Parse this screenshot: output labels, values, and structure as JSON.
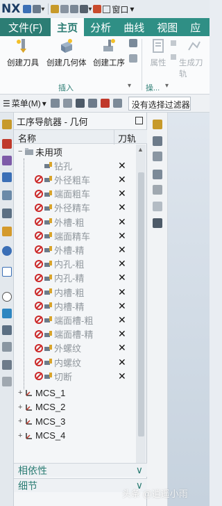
{
  "app": {
    "logo": "NX",
    "window_menu": "窗口"
  },
  "ribbon_tabs": [
    "文件(F)",
    "主页",
    "分析",
    "曲线",
    "视图",
    "应"
  ],
  "ribbon": {
    "buttons": [
      {
        "label": "创建刀具",
        "enabled": true,
        "icon": "create-tool-icon"
      },
      {
        "label": "创建几何体",
        "enabled": true,
        "icon": "create-geometry-icon"
      },
      {
        "label": "创建工序",
        "enabled": true,
        "icon": "create-operation-icon"
      },
      {
        "label": "属性",
        "enabled": false,
        "icon": "properties-icon"
      },
      {
        "label": "生成刀轨",
        "enabled": false,
        "icon": "generate-toolpath-icon"
      }
    ],
    "groups": [
      "插入",
      "操..."
    ]
  },
  "toolbar": {
    "menu_label": "菜单(M)",
    "filter_text": "没有选择过滤器"
  },
  "navigator": {
    "title": "工序导航器 - 几何",
    "col_name": "名称",
    "col_toolpath": "刀轨",
    "root": "未用项",
    "operations": [
      {
        "name": "钻孔",
        "x": true,
        "status": "none"
      },
      {
        "name": "外径粗车",
        "x": true,
        "status": "invalid"
      },
      {
        "name": "端面粗车",
        "x": true,
        "status": "invalid"
      },
      {
        "name": "外径精车",
        "x": true,
        "status": "invalid"
      },
      {
        "name": "外槽-粗",
        "x": true,
        "status": "invalid"
      },
      {
        "name": "端面精车",
        "x": true,
        "status": "invalid"
      },
      {
        "name": "外槽-精",
        "x": true,
        "status": "invalid"
      },
      {
        "name": "内孔-粗",
        "x": true,
        "status": "invalid"
      },
      {
        "name": "内孔-精",
        "x": true,
        "status": "invalid"
      },
      {
        "name": "内槽-粗",
        "x": true,
        "status": "invalid"
      },
      {
        "name": "内槽-精",
        "x": true,
        "status": "invalid"
      },
      {
        "name": "端面槽-粗",
        "x": true,
        "status": "invalid"
      },
      {
        "name": "端面槽-精",
        "x": true,
        "status": "invalid"
      },
      {
        "name": "外螺纹",
        "x": true,
        "status": "invalid"
      },
      {
        "name": "内螺纹",
        "x": true,
        "status": "invalid"
      },
      {
        "name": "切断",
        "x": true,
        "status": "invalid"
      }
    ],
    "mcs": [
      "MCS_1",
      "MCS_2",
      "MCS_3",
      "MCS_4"
    ],
    "x_glyph": "✕",
    "sections": [
      "相依性",
      "细节"
    ]
  },
  "watermark": "头条 @逍遥小雨",
  "colors": {
    "teal": "#2f8f85",
    "teal_dark": "#2c7d74",
    "red": "#cc2a2a"
  }
}
